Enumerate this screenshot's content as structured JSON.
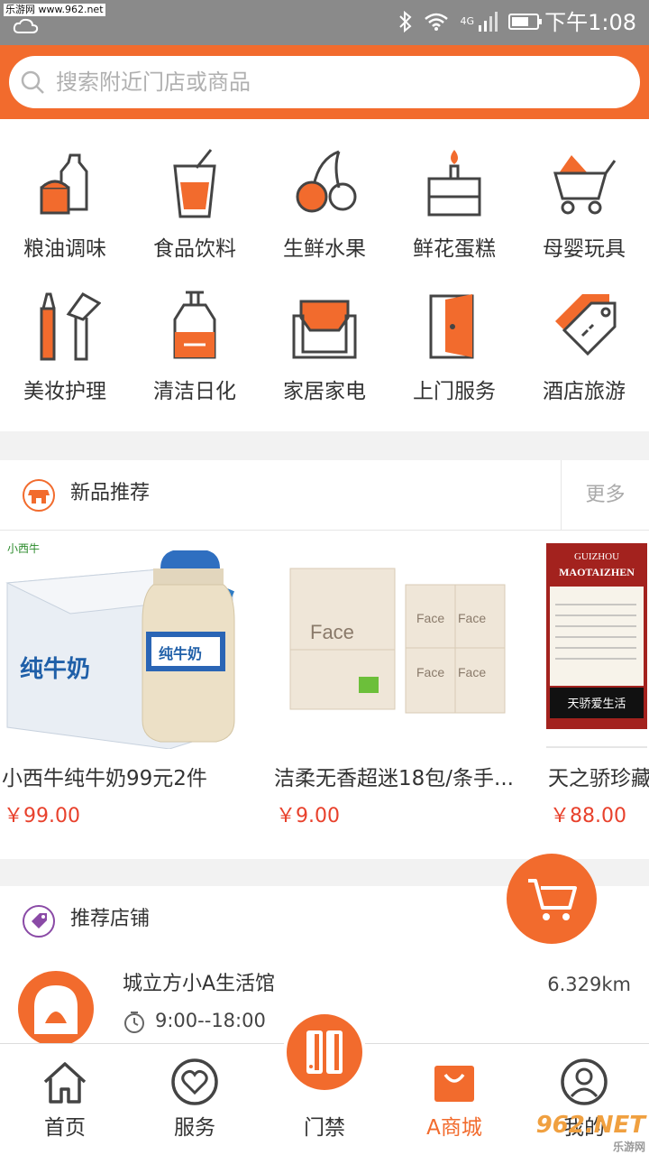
{
  "status_bar": {
    "watermark": "乐游网 www.962.net",
    "network": "4G",
    "time": "下午1:08"
  },
  "search": {
    "placeholder": "搜索附近门店或商品"
  },
  "categories": [
    {
      "label": "粮油调味",
      "icon": "oil-bottle-icon"
    },
    {
      "label": "食品饮料",
      "icon": "drink-cup-icon"
    },
    {
      "label": "生鲜水果",
      "icon": "cherry-icon"
    },
    {
      "label": "鲜花蛋糕",
      "icon": "cake-icon"
    },
    {
      "label": "母婴玩具",
      "icon": "stroller-icon"
    },
    {
      "label": "美妆护理",
      "icon": "cosmetics-icon"
    },
    {
      "label": "清洁日化",
      "icon": "pump-bottle-icon"
    },
    {
      "label": "家居家电",
      "icon": "sofa-icon"
    },
    {
      "label": "上门服务",
      "icon": "door-icon"
    },
    {
      "label": "酒店旅游",
      "icon": "tag-icon"
    }
  ],
  "new_products": {
    "title": "新品推荐",
    "more": "更多",
    "items": [
      {
        "name": "小西牛纯牛奶99元2件",
        "price": "￥99.00",
        "image_text": "纯牛奶",
        "brand": "小西牛"
      },
      {
        "name": "洁柔无香超迷18包/条手...",
        "price": "￥9.00",
        "image_text": "Face"
      },
      {
        "name": "天之骄珍藏",
        "price": "￥88.00",
        "image_text_1": "GUIZHOU",
        "image_text_2": "MAOTAIZHEN",
        "image_text_3": "天骄爱生活"
      }
    ]
  },
  "recommended_stores": {
    "title": "推荐店铺",
    "items": [
      {
        "name": "城立方小A生活馆",
        "hours": "9:00--18:00",
        "distance": "6.329km"
      }
    ]
  },
  "bottom_nav": [
    {
      "label": "首页",
      "icon": "home-icon"
    },
    {
      "label": "服务",
      "icon": "heart-icon"
    },
    {
      "label": "门禁",
      "icon": "access-gate-icon"
    },
    {
      "label": "A商城",
      "icon": "shopping-bag-icon",
      "active": true
    },
    {
      "label": "我的",
      "icon": "user-icon"
    }
  ],
  "watermark_text": "962.NET",
  "watermark_sub": "乐游网",
  "colors": {
    "accent": "#f26b2d",
    "price": "#e8412c",
    "gray_bg": "#f2f2f2"
  }
}
